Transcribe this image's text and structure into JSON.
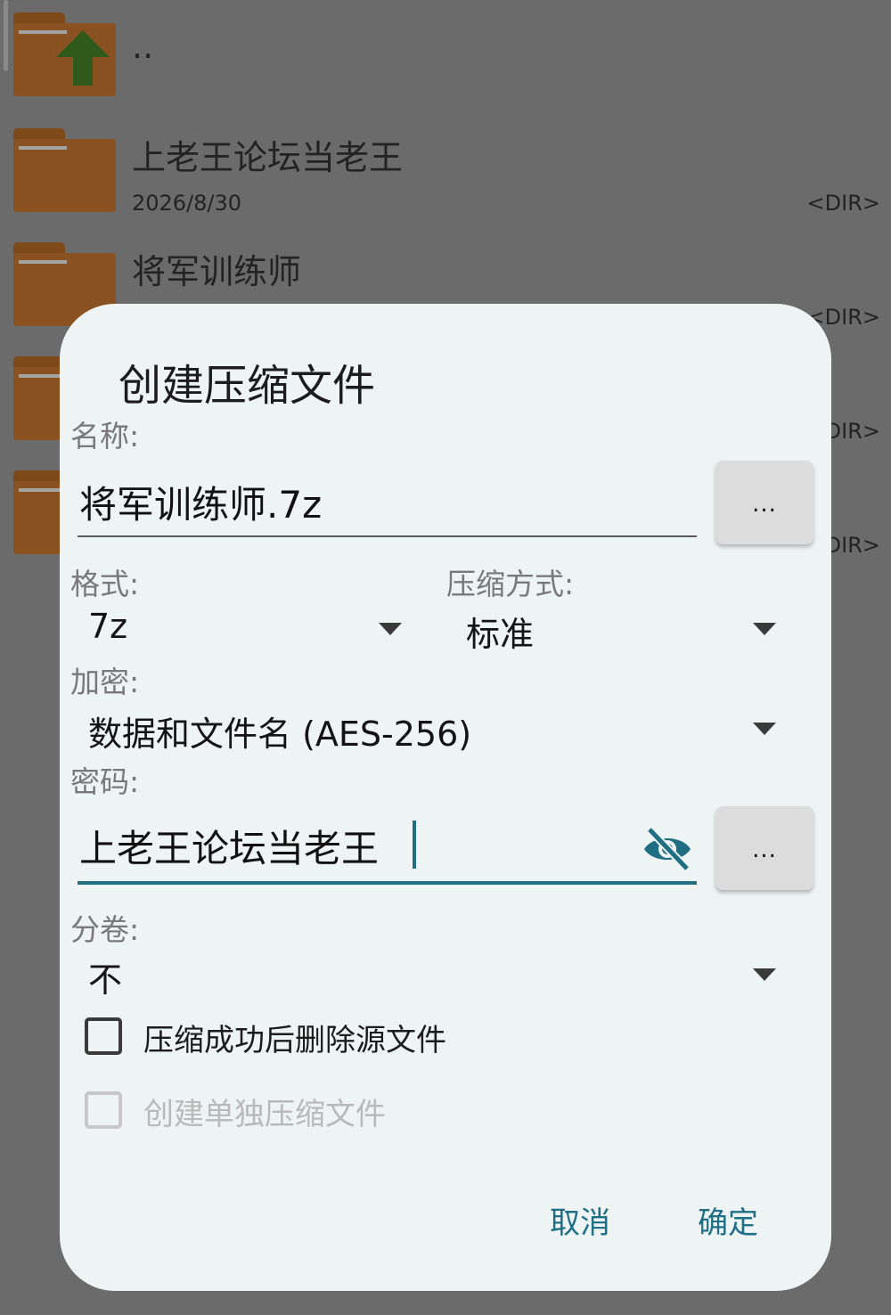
{
  "file_list": {
    "parent": {
      "name": ".."
    },
    "items": [
      {
        "name": "上老王论坛当老王",
        "date": "2026/8/30",
        "type": "<DIR>"
      },
      {
        "name": "将军训练师",
        "date": "",
        "type": "<DIR>"
      },
      {
        "name": "",
        "date": "",
        "type": "DIR>"
      },
      {
        "name": "",
        "date": "",
        "type": "DIR>"
      }
    ]
  },
  "dialog": {
    "title": "创建压缩文件",
    "name_label": "名称:",
    "name_value": "将军训练师.7z",
    "more_label": "...",
    "format_label": "格式:",
    "format_value": "7z",
    "method_label": "压缩方式:",
    "method_value": "标准",
    "encrypt_label": "加密:",
    "encrypt_value": "数据和文件名 (AES-256)",
    "password_label": "密码:",
    "password_value": "上老王论坛当老王",
    "split_label": "分卷:",
    "split_value": "不",
    "delete_source_label": "压缩成功后删除源文件",
    "delete_source_checked": false,
    "separate_archive_label": "创建单独压缩文件",
    "separate_archive_enabled": false,
    "cancel_label": "取消",
    "ok_label": "确定",
    "accent_color": "#1f6e82",
    "password_visibility_icon": "eye-off-icon"
  }
}
